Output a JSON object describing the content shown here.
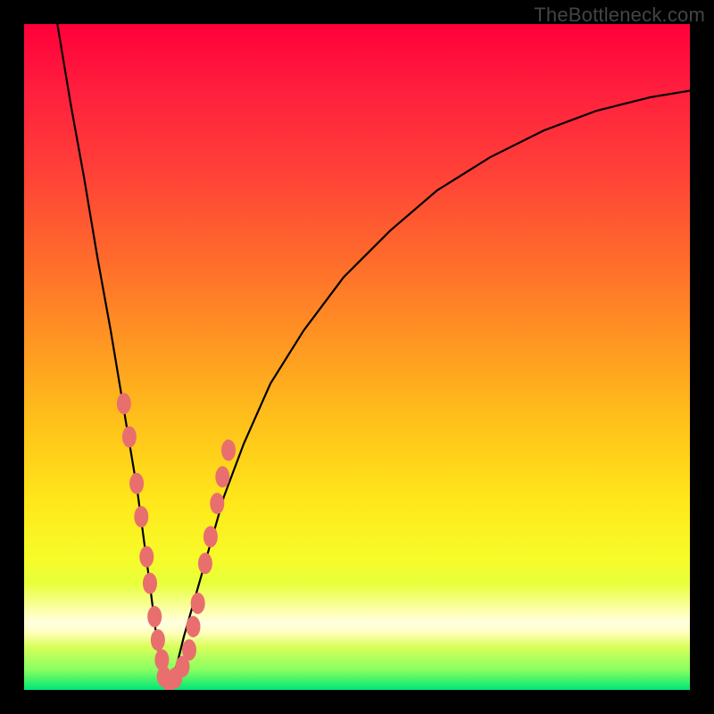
{
  "watermark": "TheBottleneck.com",
  "colors": {
    "frame": "#000000",
    "curve": "#000000",
    "dots": "#e96f6f",
    "gradient_top": "#ff003a",
    "gradient_bottom": "#00e676"
  },
  "chart_data": {
    "type": "line",
    "title": "",
    "xlabel": "",
    "ylabel": "",
    "xlim": [
      0,
      100
    ],
    "ylim": [
      0,
      100
    ],
    "note": "Axes are normalized 0–100 (no tick labels in source). y = 100 is top (red), y = 0 is bottom (green). Curve is a V-shaped bottleneck profile with minimum near x ≈ 21.",
    "series": [
      {
        "name": "bottleneck-curve",
        "x": [
          5,
          7,
          9,
          11,
          13,
          15,
          17,
          19,
          20,
          21,
          22,
          23,
          24,
          26,
          28,
          30,
          33,
          37,
          42,
          48,
          55,
          62,
          70,
          78,
          86,
          94,
          100
        ],
        "y": [
          100,
          88,
          77,
          65,
          54,
          42,
          30,
          15,
          7,
          1,
          1,
          4,
          8,
          15,
          22,
          29,
          37,
          46,
          54,
          62,
          69,
          75,
          80,
          84,
          87,
          89,
          90
        ]
      }
    ],
    "annotations": {
      "dots_description": "Salmon points clustered on both arms of the V near the trough",
      "dots": [
        {
          "x": 15.0,
          "y": 43
        },
        {
          "x": 15.8,
          "y": 38
        },
        {
          "x": 16.9,
          "y": 31
        },
        {
          "x": 17.6,
          "y": 26
        },
        {
          "x": 18.4,
          "y": 20
        },
        {
          "x": 18.9,
          "y": 16
        },
        {
          "x": 19.6,
          "y": 11
        },
        {
          "x": 20.1,
          "y": 7.5
        },
        {
          "x": 20.7,
          "y": 4.5
        },
        {
          "x": 21.0,
          "y": 2.0
        },
        {
          "x": 21.8,
          "y": 1.3
        },
        {
          "x": 22.7,
          "y": 1.8
        },
        {
          "x": 23.8,
          "y": 3.5
        },
        {
          "x": 24.8,
          "y": 6.0
        },
        {
          "x": 25.4,
          "y": 9.5
        },
        {
          "x": 26.1,
          "y": 13
        },
        {
          "x": 27.2,
          "y": 19
        },
        {
          "x": 28.0,
          "y": 23
        },
        {
          "x": 29.0,
          "y": 28
        },
        {
          "x": 29.8,
          "y": 32
        },
        {
          "x": 30.7,
          "y": 36
        }
      ]
    }
  }
}
